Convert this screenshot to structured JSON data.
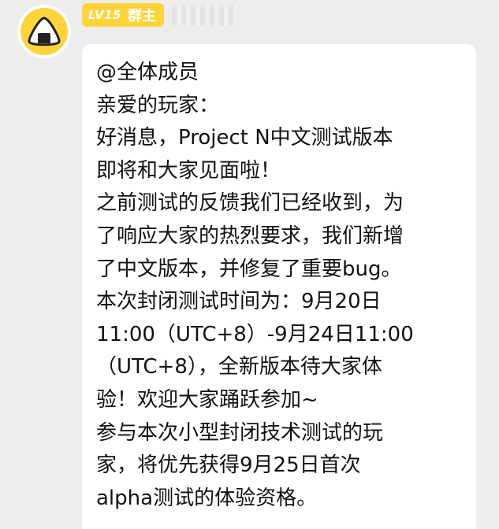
{
  "sender": {
    "badge": {
      "level": "LV15",
      "role": "群主",
      "color": "#ffd43b"
    },
    "name_blurred": true
  },
  "message": {
    "lines": [
      "@全体成员",
      "亲爱的玩家：",
      "好消息，Project N中文测试版本",
      "即将和大家见面啦！",
      "之前测试的反馈我们已经收到，为",
      "了响应大家的热烈要求，我们新增",
      "了中文版本，并修复了重要bug。",
      "本次封闭测试时间为：9月20日",
      "11:00（UTC+8）-9月24日11:00",
      "（UTC+8），全新版本待大家体",
      "验！欢迎大家踊跃参加~",
      "参与本次小型封闭技术测试的玩",
      "家，将优先获得9月25日首次",
      "alpha测试的体验资格。"
    ]
  },
  "colors": {
    "background": "#ededed",
    "bubble": "#ffffff",
    "text": "#111111"
  },
  "icons": {
    "avatar": "onigiri-icon"
  }
}
